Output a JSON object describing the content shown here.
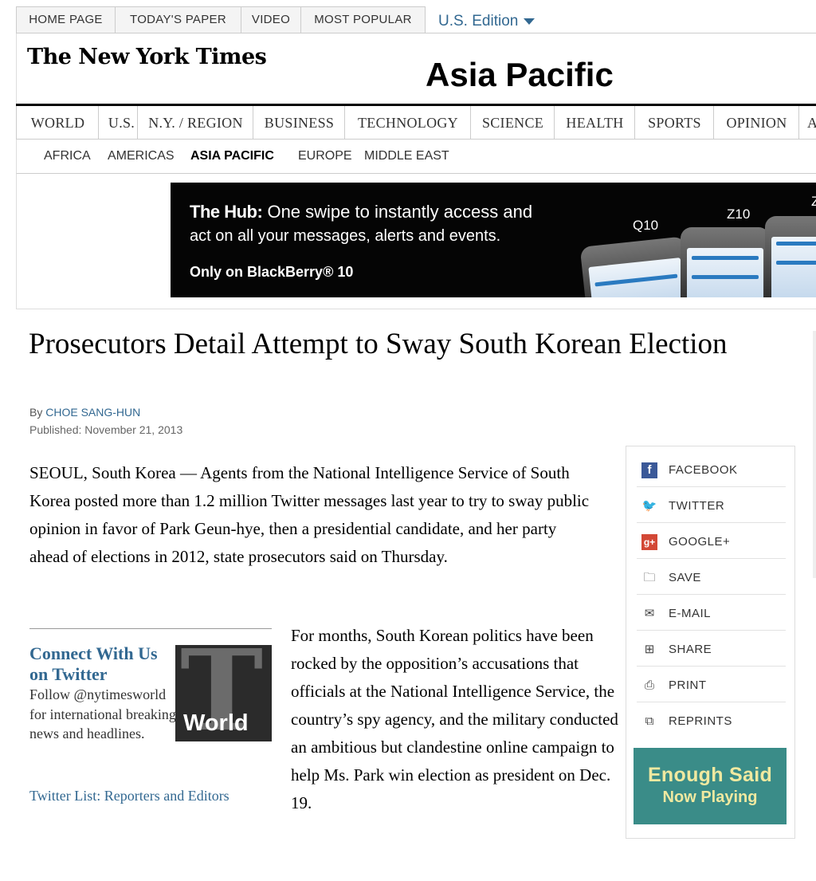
{
  "topnav": {
    "tabs": [
      "HOME PAGE",
      "TODAY'S PAPER",
      "VIDEO",
      "MOST POPULAR"
    ],
    "edition": "U.S. Edition"
  },
  "masthead": {
    "logo": "The New York Times",
    "section": "Asia Pacific"
  },
  "sections": [
    "WORLD",
    "U.S.",
    "N.Y. / REGION",
    "BUSINESS",
    "TECHNOLOGY",
    "SCIENCE",
    "HEALTH",
    "SPORTS",
    "OPINION",
    "A"
  ],
  "subsections": [
    "AFRICA",
    "AMERICAS",
    "ASIA PACIFIC",
    "EUROPE",
    "MIDDLE EAST"
  ],
  "active_subsection": "ASIA PACIFIC",
  "ad": {
    "brand": "The Hub:",
    "line1": "One swipe to instantly access and",
    "line2": "act on all your messages, alerts and events.",
    "cta": "Only on BlackBerry® 10",
    "models": [
      "Q10",
      "Z10",
      "Z"
    ]
  },
  "article": {
    "headline": "Prosecutors Detail Attempt to Sway South Korean Election",
    "byline_prefix": "By",
    "author": "CHOE SANG-HUN",
    "published": "Published: November 21, 2013",
    "lede": "SEOUL, South Korea — Agents from the National Intelligence Service of South Korea posted more than 1.2 million Twitter messages last year to try to sway public opinion in favor of Park Geun-hye, then a presidential candidate, and her party ahead of elections in 2012, state prosecutors said on Thursday.",
    "para2": "For months, South Korean politics have been rocked by the opposition’s accusations that officials at the National Intelligence Service, the country’s spy agency, and the military conducted an ambitious but clandestine online campaign to help Ms. Park win election as president on Dec. 19."
  },
  "promo": {
    "title": "Connect With Us on Twitter",
    "follow": "Follow @nytimesworld for international breaking news and headlines.",
    "list_link": "Twitter List: Reporters and Editors",
    "logo_text": "World"
  },
  "share": {
    "items": [
      {
        "label": "FACEBOOK",
        "icon": "facebook-icon",
        "glyph": "f"
      },
      {
        "label": "TWITTER",
        "icon": "twitter-icon",
        "glyph": "🐦"
      },
      {
        "label": "GOOGLE+",
        "icon": "google-plus-icon",
        "glyph": "g+"
      },
      {
        "label": "SAVE",
        "icon": "folder-icon",
        "glyph": "🗀"
      },
      {
        "label": "E-MAIL",
        "icon": "envelope-icon",
        "glyph": "✉"
      },
      {
        "label": "SHARE",
        "icon": "plus-box-icon",
        "glyph": "⊞"
      },
      {
        "label": "PRINT",
        "icon": "printer-icon",
        "glyph": "⎙"
      },
      {
        "label": "REPRINTS",
        "icon": "reprints-icon",
        "glyph": "⧉"
      }
    ]
  },
  "video_promo": {
    "title": "Enough Said",
    "subtitle": "Now Playing"
  },
  "colors": {
    "link": "#326891",
    "promo_bg": "#3a8c88",
    "promo_text": "#f0e9a0"
  }
}
